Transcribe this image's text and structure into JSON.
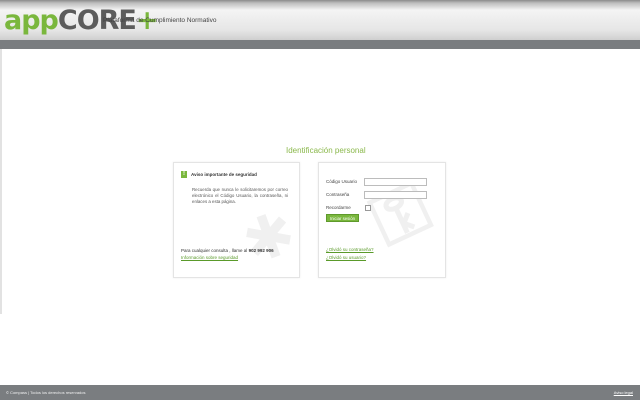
{
  "header": {
    "logo_app": "app",
    "logo_core": "CORE",
    "logo_plus": "+",
    "subtitle": "Plataforma de Cumplimiento Normativo"
  },
  "main": {
    "title": "Identificación personal",
    "notice": {
      "icon": "!",
      "heading": "Aviso importante de seguridad",
      "body": "Recuerda que nunca le solicitaremos por correo electrónico el Código Usuario, la contraseña, ni enlaces a esta página.",
      "contact_prefix": "Para cualquier consulta , llame al",
      "contact_phone": "902 992 906",
      "info_link": "Información sobre seguridad"
    },
    "login": {
      "user_label": "Código Usuario",
      "user_value": "",
      "password_label": "Contraseña",
      "password_value": "",
      "remember_label": "Recordarme",
      "submit_label": "Iniciar sesión",
      "forgot_password": "¿Olvidó su contraseña?",
      "forgot_user": "¿Olvidó su usuario?"
    }
  },
  "footer": {
    "copyright": "© Compass | Todos los derechos reservados",
    "legal_link": "Aviso legal"
  },
  "colors": {
    "accent_green": "#7ab73d",
    "bar_gray": "#7a7d80"
  }
}
